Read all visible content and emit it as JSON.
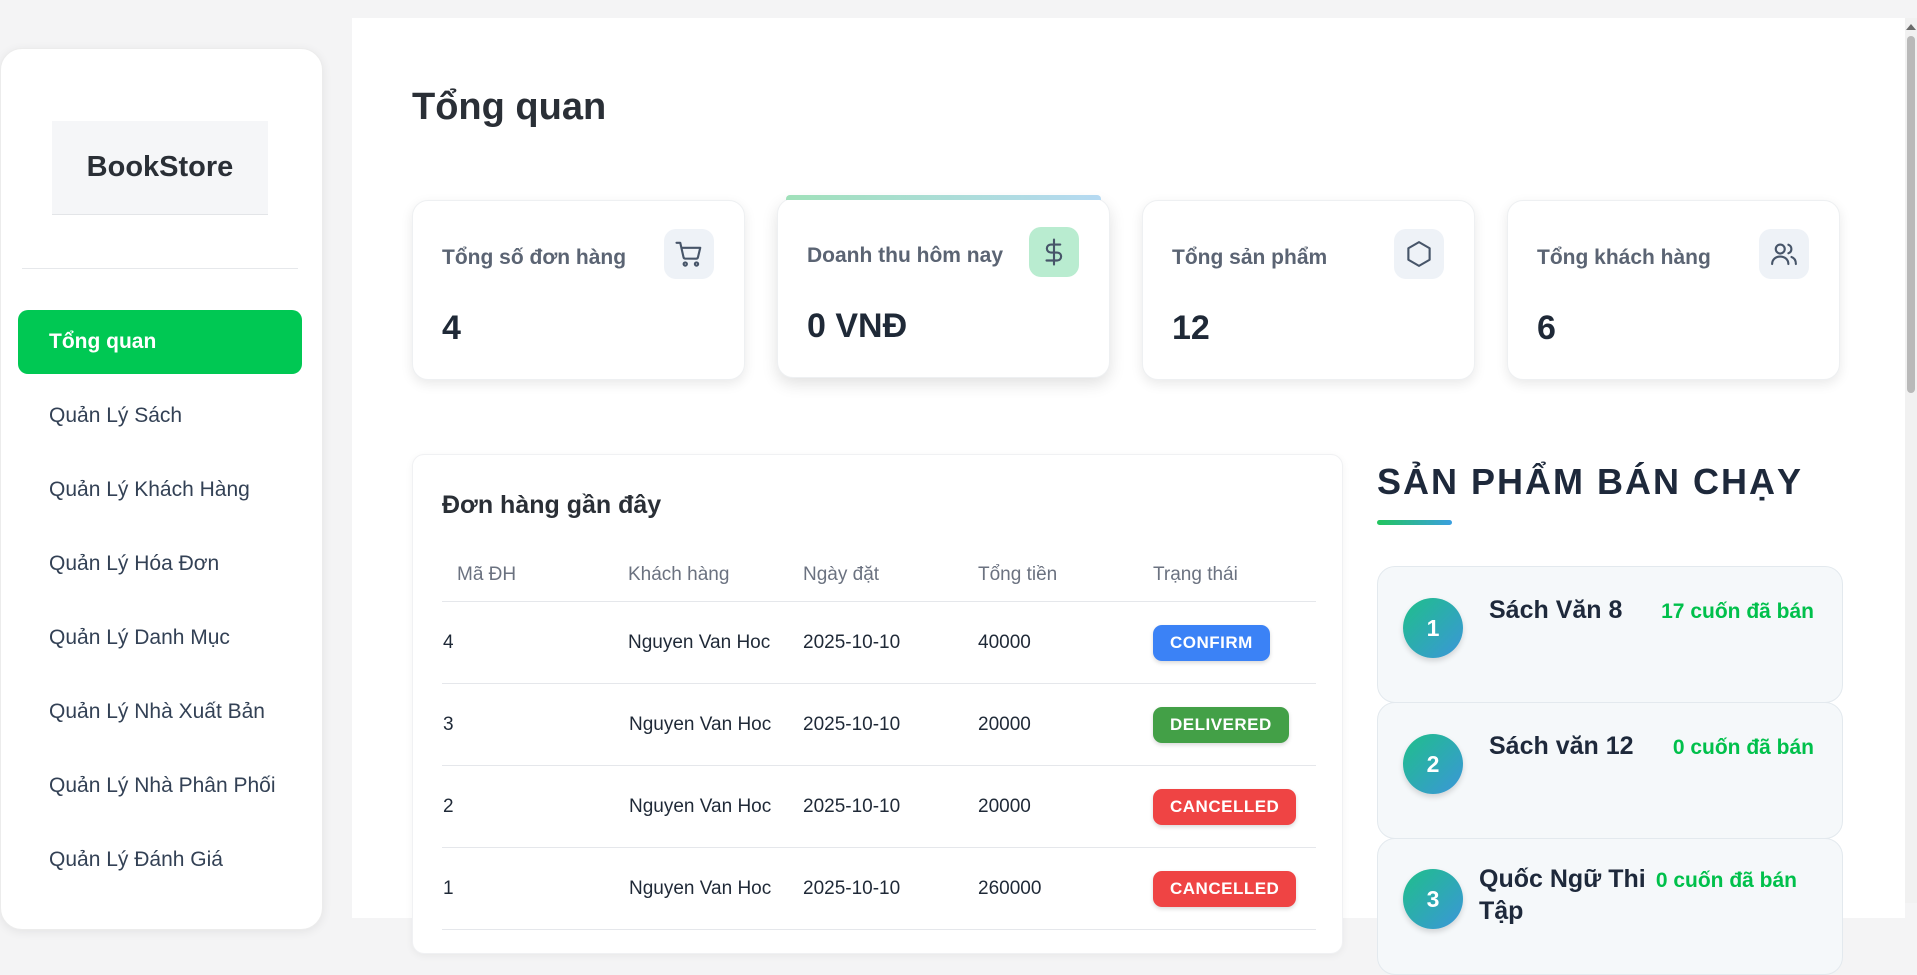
{
  "sidebar": {
    "brand": "BookStore",
    "items": [
      {
        "label": "Tổng quan",
        "active": true
      },
      {
        "label": "Quản Lý Sách"
      },
      {
        "label": "Quản Lý Khách Hàng"
      },
      {
        "label": "Quản Lý Hóa Đơn"
      },
      {
        "label": "Quản Lý Danh Mục"
      },
      {
        "label": "Quản Lý Nhà Xuất Bản"
      },
      {
        "label": "Quản Lý Nhà Phân Phối"
      },
      {
        "label": "Quản Lý Đánh Giá"
      }
    ]
  },
  "main": {
    "title": "Tổng quan",
    "stats": [
      {
        "label": "Tổng số đơn hàng",
        "value": "4",
        "icon": "cart-icon"
      },
      {
        "label": "Doanh thu hôm nay",
        "value": "0 VNĐ",
        "icon": "dollar-icon"
      },
      {
        "label": "Tổng sản phẩm",
        "value": "12",
        "icon": "box-icon"
      },
      {
        "label": "Tổng khách hàng",
        "value": "6",
        "icon": "users-icon"
      }
    ],
    "orders": {
      "title": "Đơn hàng gần đây",
      "columns": [
        "Mã ĐH",
        "Khách hàng",
        "Ngày đặt",
        "Tổng tiền",
        "Trạng thái"
      ],
      "rows": [
        {
          "id": "4",
          "customer": "Nguyen Van Hoc",
          "date": "2025-10-10",
          "total": "40000",
          "status": "CONFIRM"
        },
        {
          "id": "3",
          "customer": "Nguyen Van Hoc",
          "date": "2025-10-10",
          "total": "20000",
          "status": "DELIVERED"
        },
        {
          "id": "2",
          "customer": "Nguyen Van Hoc",
          "date": "2025-10-10",
          "total": "20000",
          "status": "CANCELLED"
        },
        {
          "id": "1",
          "customer": "Nguyen Van Hoc",
          "date": "2025-10-10",
          "total": "260000",
          "status": "CANCELLED"
        }
      ]
    },
    "bestsellers": {
      "title": "SẢN PHẨM BÁN CHẠY",
      "items": [
        {
          "rank": "1",
          "name": "Sách Văn 8",
          "sold": "17 cuốn đã bán"
        },
        {
          "rank": "2",
          "name": "Sách văn 12",
          "sold": "0 cuốn đã bán"
        },
        {
          "rank": "3",
          "name": "Quốc Ngữ Thi Tập",
          "sold": "0 cuốn đã bán"
        }
      ]
    }
  },
  "colors": {
    "accent_green": "#00c853",
    "status_confirm": "#3b82f6",
    "status_delivered": "#43a047",
    "status_cancelled": "#ef4444",
    "sold_text": "#00c04b"
  }
}
